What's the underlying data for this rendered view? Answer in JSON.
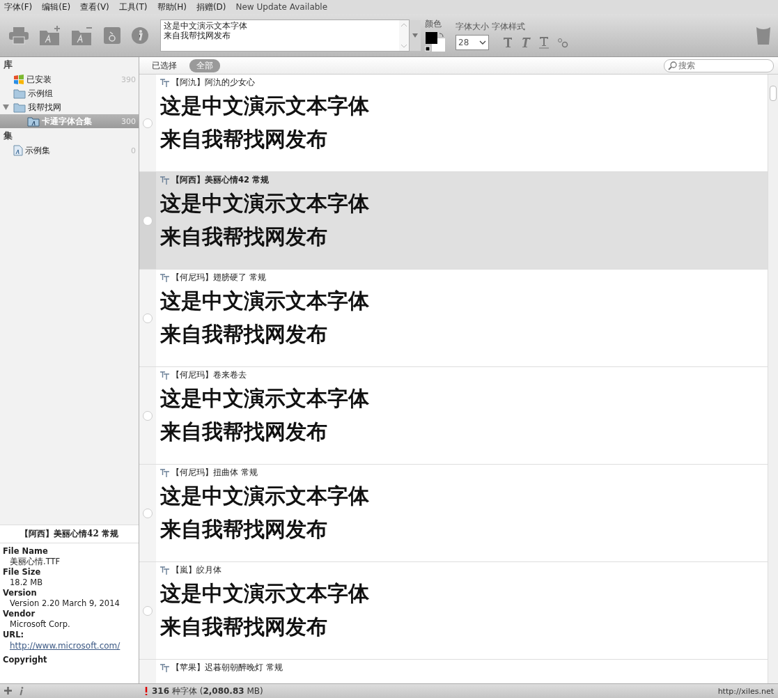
{
  "menu": [
    {
      "label": "字体(F)"
    },
    {
      "label": "编辑(E)"
    },
    {
      "label": "查看(V)"
    },
    {
      "label": "工具(T)"
    },
    {
      "label": "帮助(H)"
    },
    {
      "label": "捐赠(D)"
    }
  ],
  "update_notice": "New Update Available",
  "toolbar": {
    "sample_lines": [
      "这是中文演示文本字体",
      "来自我帮找网发布"
    ],
    "color_label": "颜色",
    "size_label": "字体大小",
    "style_label": "字体样式",
    "font_size": "28"
  },
  "sidebar": {
    "sections": [
      {
        "title": "库",
        "items": [
          {
            "label": "已安装",
            "count": "390",
            "kind": "installed",
            "selected": false
          },
          {
            "label": "示例组",
            "kind": "folder",
            "selected": false
          },
          {
            "label": "我帮找网",
            "kind": "folder",
            "expanded": true,
            "selected": false,
            "children": [
              {
                "label": "卡通字体合集",
                "count": "300",
                "kind": "fontset",
                "selected": true
              }
            ]
          }
        ]
      },
      {
        "title": "集",
        "items": [
          {
            "label": "示例集",
            "count": "0",
            "kind": "set",
            "selected": false
          }
        ]
      }
    ]
  },
  "filter_tabs": [
    {
      "label": "已选择",
      "selected": false
    },
    {
      "label": "全部",
      "selected": true
    }
  ],
  "search": {
    "placeholder": "搜索"
  },
  "fonts": [
    {
      "name": "【阿氿】阿氿的少女心",
      "selected": false,
      "checked": false,
      "sample_lines": [
        "这是中文演示文本字体",
        "来自我帮找网发布"
      ]
    },
    {
      "name": "【阿西】美丽心情42 常规",
      "selected": true,
      "checked": false,
      "sample_lines": [
        "这是中文演示文本字体",
        "来自我帮找网发布"
      ]
    },
    {
      "name": "【何尼玛】翅膀硬了 常规",
      "selected": false,
      "checked": false,
      "sample_lines": [
        "这是中文演示文本字体",
        "来自我帮找网发布"
      ]
    },
    {
      "name": "【何尼玛】卷来卷去",
      "selected": false,
      "checked": false,
      "sample_lines": [
        "这是中文演示文本字体",
        "来自我帮找网发布"
      ]
    },
    {
      "name": "【何尼玛】扭曲体 常规",
      "selected": false,
      "checked": false,
      "sample_lines": [
        "这是中文演示文本字体",
        "来自我帮找网发布"
      ]
    },
    {
      "name": "【嵐】皎月体",
      "selected": false,
      "checked": false,
      "sample_lines": [
        "这是中文演示文本字体",
        "来自我帮找网发布"
      ]
    },
    {
      "name": "【苹果】迟暮朝朝醉晚灯 常规",
      "selected": false
    }
  ],
  "info": {
    "title": "【阿西】美丽心情42 常规",
    "fields": [
      {
        "label": "File Name",
        "value": "美丽心情.TTF",
        "kind": "text"
      },
      {
        "label": "File Size",
        "value": "18.2 MB",
        "kind": "text"
      },
      {
        "label": "Version",
        "value": "Version 2.20 March 9, 2014",
        "kind": "text"
      },
      {
        "label": "Vendor",
        "value": "Microsoft Corp.",
        "kind": "text"
      },
      {
        "label": "URL:",
        "value": "http://www.microsoft.com/",
        "kind": "link"
      },
      {
        "label": "Copyright"
      }
    ]
  },
  "status": {
    "summary": "**316** 种字体 (**2,080.83** MB)",
    "link": "http://xiles.net"
  }
}
